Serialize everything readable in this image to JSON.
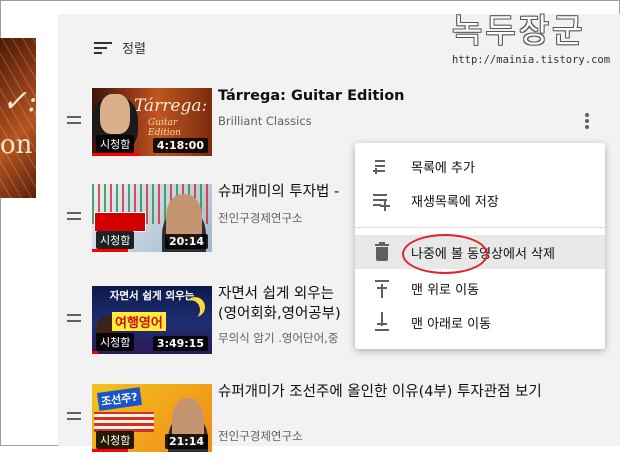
{
  "watermark": {
    "title": "녹두장군",
    "url": "http://mainia.tistory.com"
  },
  "sort": {
    "label": "정렬",
    "icon": "sort-icon"
  },
  "videos": [
    {
      "title": "Tárrega: Guitar Edition",
      "channel": "Brilliant Classics",
      "watched_label": "시청함",
      "duration": "4:18:00",
      "thumb_text": {
        "name": "Tárrega:",
        "sub": "Guitar Edition"
      },
      "progress": 0.4
    },
    {
      "title": "슈퍼개미의 투자법 -",
      "channel": "전인구경제연구소",
      "watched_label": "시청함",
      "duration": "20:14",
      "progress": 0.3
    },
    {
      "title": "자면서 쉽게 외우는",
      "title_line2": "(영어회화,영어공부)",
      "channel": "무의식 암기 .영어단어,중",
      "watched_label": "시청함",
      "duration": "3:49:15",
      "thumb_text": {
        "top": "자면서 쉽게 외우는",
        "big": "여행영어"
      },
      "progress": 0.05
    },
    {
      "title": "슈퍼개미가 조선주에 올인한 이유(4부) 투자관점 보기",
      "channel": "전인구경제연구소",
      "watched_label": "시청함",
      "duration": "21:14",
      "thumb_text": {
        "tag": "조선주?"
      },
      "progress": 0.3
    }
  ],
  "menu": {
    "items": [
      {
        "label": "목록에 추가",
        "icon": "add-to-queue-icon"
      },
      {
        "label": "재생목록에 저장",
        "icon": "playlist-add-icon"
      },
      {
        "label": "나중에 볼 동영상에서 삭제",
        "icon": "trash-icon",
        "highlighted": true
      },
      {
        "label": "맨 위로 이동",
        "icon": "move-to-top-icon"
      },
      {
        "label": "맨 아래로 이동",
        "icon": "move-to-bottom-icon"
      }
    ]
  },
  "colors": {
    "panel": "#f2f2f2",
    "progress": "#ff0000",
    "annotation": "#e0242a"
  }
}
